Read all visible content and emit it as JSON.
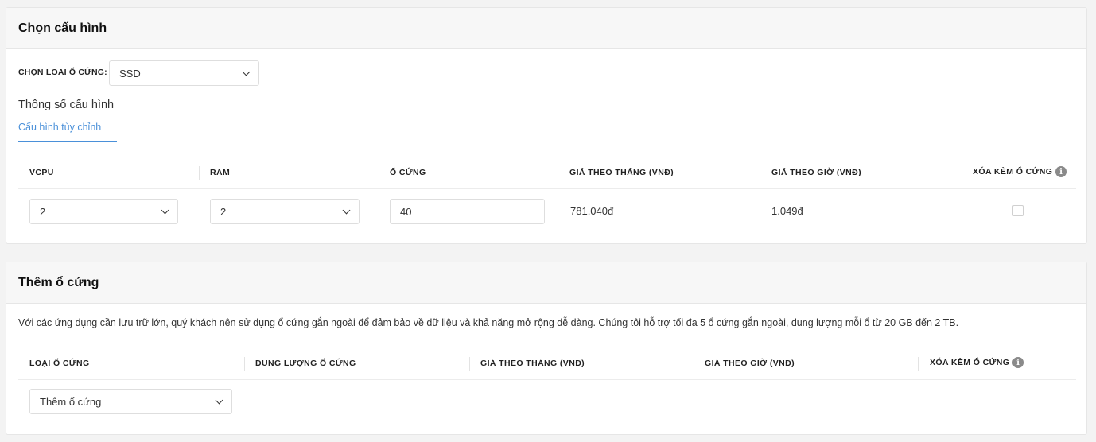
{
  "config_section": {
    "title": "Chọn cấu hình",
    "disk_type_label": "CHỌN LOẠI Ổ CỨNG:",
    "disk_type_value": "SSD",
    "spec_title": "Thông số cấu hình",
    "tab_custom": "Cấu hình tùy chỉnh",
    "table": {
      "headers": {
        "vcpu": "VCPU",
        "ram": "RAM",
        "disk": "Ổ CỨNG",
        "monthly": "GIÁ THEO THÁNG (VNĐ)",
        "hourly": "GIÁ THEO GIỜ (VNĐ)",
        "delete_with": "XÓA KÈM Ổ CỨNG"
      },
      "row": {
        "vcpu": "2",
        "ram": "2",
        "disk": "40",
        "monthly": "781.040đ",
        "hourly": "1.049đ",
        "delete_checked": false
      }
    }
  },
  "add_disk_section": {
    "title": "Thêm ổ cứng",
    "description": "Với các ứng dụng cần lưu trữ lớn, quý khách nên sử dụng ổ cứng gắn ngoài để đảm bảo về dữ liệu và khả năng mở rộng dễ dàng. Chúng tôi hỗ trợ tối đa 5 ổ cứng gắn ngoài, dung lượng mỗi ổ từ 20 GB đến 2 TB.",
    "table": {
      "headers": {
        "type": "LOẠI Ổ CỨNG",
        "capacity": "DUNG LƯỢNG Ổ CỨNG",
        "monthly": "GIÁ THEO THÁNG (VNĐ)",
        "hourly": "GIÁ THEO GIỜ (VNĐ)",
        "delete_with": "XÓA KÈM Ổ CỨNG"
      },
      "add_placeholder": "Thêm ổ cứng"
    }
  },
  "icons": {
    "info": "info-icon",
    "dropdown": "chevron-down-icon"
  },
  "colors": {
    "accent": "#4a90d9"
  }
}
